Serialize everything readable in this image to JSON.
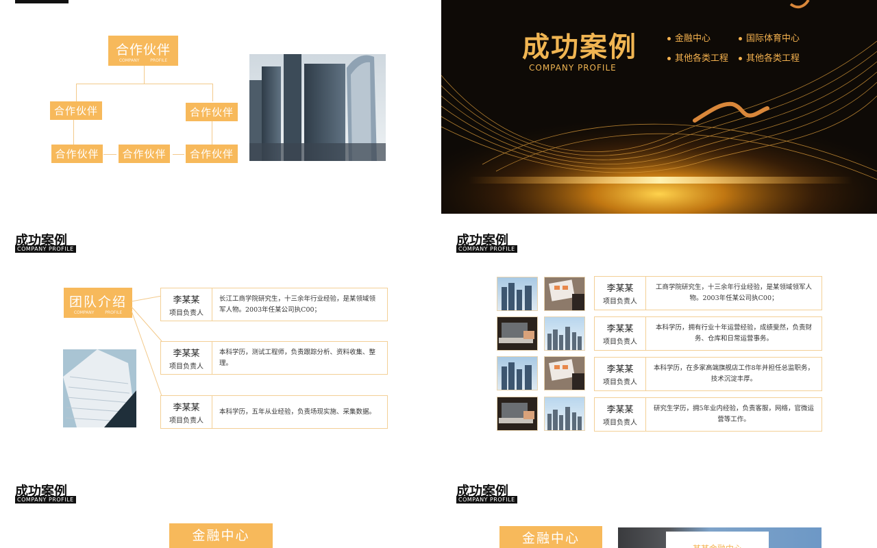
{
  "slide_partners": {
    "main_box": "合作伙伴",
    "main_box_sub": "COMPANY PROFILE",
    "nodes": [
      "合作伙伴",
      "合作伙伴",
      "合作伙伴",
      "合作伙伴",
      "合作伙伴"
    ],
    "photo_icon": "city-skyscrapers-image"
  },
  "slide_cover": {
    "title": "成功案例",
    "subtitle": "COMPANY PROFILE",
    "bullets": [
      "金融中心",
      "国际体育中心",
      "其他各类工程",
      "其他各类工程"
    ]
  },
  "header": {
    "title": "成功案例",
    "subtitle": "COMPANY PROFILE"
  },
  "slide_team": {
    "badge": "团队介绍",
    "badge_sub": "COMPANY PROFILE",
    "rows": [
      {
        "name": "李某某",
        "role": "项目负责人",
        "desc": "长江工商学院研究生，十三余年行业经验，是某领域领军人物。2003年任某公司执C00；"
      },
      {
        "name": "李某某",
        "role": "项目负责人",
        "desc": "本科学历，测试工程师，负责跟踪分析、资料收集、整理。"
      },
      {
        "name": "李某某",
        "role": "项目负责人",
        "desc": "本科学历，五年从业经验，负责场现实施、采集数据。"
      }
    ]
  },
  "slide_team2": {
    "rows": [
      {
        "name": "李某某",
        "role": "项目负责人",
        "desc": "工商学院研究生，十三余年行业经验，是某领域领军人物。2003年任某公司执C00；"
      },
      {
        "name": "李某某",
        "role": "项目负责人",
        "desc": "本科学历，拥有行业十年运营经验，成绩斐然，负责财务、仓库和日常运营事务。"
      },
      {
        "name": "李某某",
        "role": "项目负责人",
        "desc": "本科学历，在多家高端旗舰店工作8年并担任总监职务，技术沉淀丰厚。"
      },
      {
        "name": "李某某",
        "role": "项目负责人",
        "desc": "研究生学历，拥5年业内经验，负责客服，网络，官微运营等工作。"
      }
    ]
  },
  "slide_bottom_left": {
    "badge": "金融中心"
  },
  "slide_bottom_right": {
    "badge": "金融中心",
    "photo_caption": "某某金融中心"
  },
  "colors": {
    "accent": "#f7b95b",
    "accent_text": "#f5b24f",
    "dark_bg": "#0e0a06"
  }
}
